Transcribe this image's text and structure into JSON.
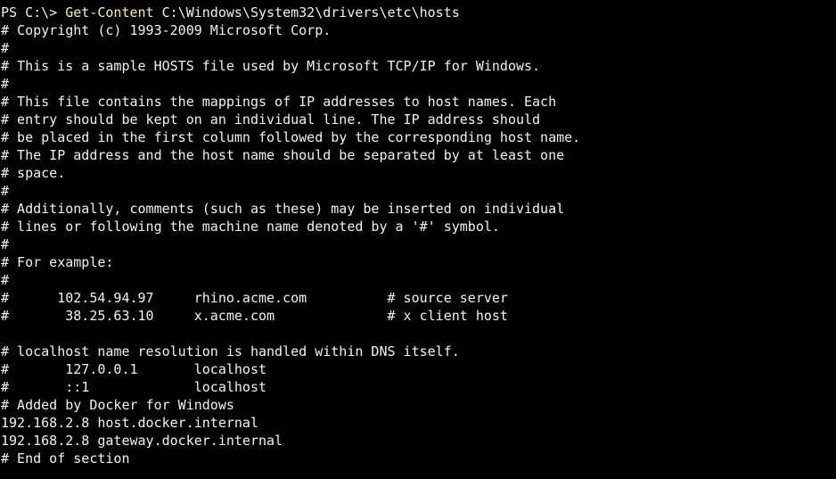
{
  "prompt": {
    "text": "PS C:\\> ",
    "command": "Get-Content",
    "argument": " C:\\Windows\\System32\\drivers\\etc\\hosts"
  },
  "output_lines": [
    "# Copyright (c) 1993-2009 Microsoft Corp.",
    "#",
    "# This is a sample HOSTS file used by Microsoft TCP/IP for Windows.",
    "#",
    "# This file contains the mappings of IP addresses to host names. Each",
    "# entry should be kept on an individual line. The IP address should",
    "# be placed in the first column followed by the corresponding host name.",
    "# The IP address and the host name should be separated by at least one",
    "# space.",
    "#",
    "# Additionally, comments (such as these) may be inserted on individual",
    "# lines or following the machine name denoted by a '#' symbol.",
    "#",
    "# For example:",
    "#",
    "#      102.54.94.97     rhino.acme.com          # source server",
    "#       38.25.63.10     x.acme.com              # x client host",
    "",
    "# localhost name resolution is handled within DNS itself.",
    "#       127.0.0.1       localhost",
    "#       ::1             localhost",
    "# Added by Docker for Windows",
    "192.168.2.8 host.docker.internal",
    "192.168.2.8 gateway.docker.internal",
    "# End of section"
  ],
  "colors": {
    "background": "#000000",
    "text": "#f2f2f2",
    "command": "#f9f1a5"
  }
}
